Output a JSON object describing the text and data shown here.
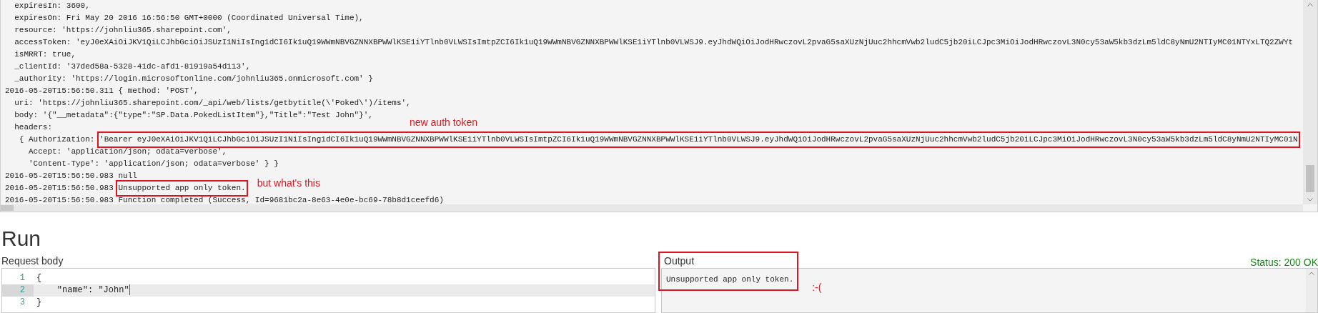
{
  "log": {
    "lines": [
      {
        "text": "  expiresIn: 3600,"
      },
      {
        "text": "  expiresOn: Fri May 20 2016 16:56:50 GMT+0000 (Coordinated Universal Time),"
      },
      {
        "text": "  resource: 'https://johnliu365.sharepoint.com',"
      },
      {
        "text": "  accessToken: 'eyJ0eXAiOiJKV1QiLCJhbGciOiJSUzI1NiIsIng1dCI6Ik1uQ19WWmNBVGZNNXBPWWlKSE1iYTlnb0VLWSIsImtpZCI6Ik1uQ19WWmNBVGZNNXBPWWlKSE1iYTlnb0VLWSJ9.eyJhdWQiOiJodHRwczovL2pvaG5saXUzNjUuc2hhcmVwb2ludC5jb20iLCJpc3MiOiJodHRwczovL3N0cy53aW5kb3dzLm5ldC8yNmU2NTIyMC01NTYxLTQ2ZWYt"
      },
      {
        "text": "  isMRRT: true,"
      },
      {
        "text": "  _clientId: '37ded58a-5328-41dc-afd1-81919a54d113',"
      },
      {
        "text": "  _authority: 'https://login.microsoftonline.com/johnliu365.onmicrosoft.com' }"
      },
      {
        "text": "2016-05-20T15:56:50.311 { method: 'POST',"
      },
      {
        "text": "  uri: 'https://johnliu365.sharepoint.com/_api/web/lists/getbytitle(\\'Poked\\')/items',"
      },
      {
        "text": "  body: '{\"__metadata\":{\"type\":\"SP.Data.PokedListItem\"},\"Title\":\"Test John\"}',"
      },
      {
        "text": "  headers:",
        "note": "new auth token"
      },
      {
        "text": "   { Authorization: ",
        "boxed": "'Bearer eyJ0eXAiOiJKV1QiLCJhbGciOiJSUzI1NiIsIng1dCI6Ik1uQ19WWmNBVGZNNXBPWWlKSE1iYTlnb0VLWSIsImtpZCI6Ik1uQ19WWmNBVGZNNXBPWWlKSE1iYTlnb0VLWSJ9.eyJhdWQiOiJodHRwczovL2pvaG5saXUzNjUuc2hhcmVwb2ludC5jb20iLCJpc3MiOiJodHRwczovL3N0cy53aW5kb3dzLm5ldC8yNmU2NTIyMC01N"
      },
      {
        "text": "     Accept: 'application/json; odata=verbose',"
      },
      {
        "text": "     'Content-Type': 'application/json; odata=verbose' } }"
      },
      {
        "text": "2016-05-20T15:56:50.983 null"
      },
      {
        "text": "2016-05-20T15:56:50.983 ",
        "boxed": "Unsupported app only token.",
        "note": "but what's this"
      },
      {
        "text": "2016-05-20T15:56:50.983 Function completed (Success, Id=9681bc2a-8e63-4e0e-bc69-78b8d1ceefd6)"
      }
    ]
  },
  "run": {
    "title": "Run",
    "request": {
      "label": "Request body",
      "lines": [
        {
          "number": "1",
          "code": "{",
          "current": false
        },
        {
          "number": "2",
          "code": "    \"name\": \"John\"",
          "current": true
        },
        {
          "number": "3",
          "code": "}",
          "current": false
        }
      ]
    },
    "output": {
      "label": "Output",
      "status": "Status: 200 OK",
      "text": "Unsupported app only token.",
      "boxed": true,
      "note": ":-("
    }
  }
}
